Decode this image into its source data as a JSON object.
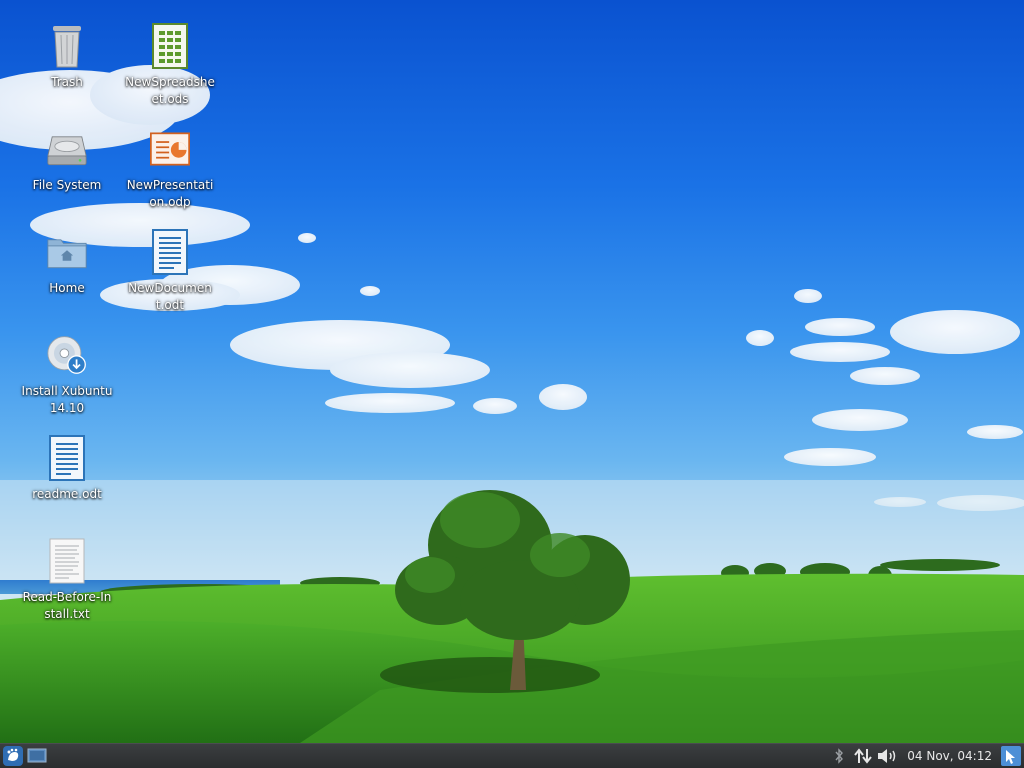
{
  "desktop": {
    "icons": [
      {
        "label": "Trash",
        "icon": "trash-icon"
      },
      {
        "label": "NewSpreadsheet.ods",
        "icon": "spreadsheet-file-icon"
      },
      {
        "label": "File System",
        "icon": "harddrive-icon"
      },
      {
        "label": "NewPresentation.odp",
        "icon": "presentation-file-icon"
      },
      {
        "label": "Home",
        "icon": "home-folder-icon"
      },
      {
        "label": "NewDocument.odt",
        "icon": "document-file-icon"
      },
      {
        "label": "Install Xubuntu 14.10",
        "icon": "install-disc-icon"
      },
      {
        "label": "readme.odt",
        "icon": "document-file-icon"
      },
      {
        "label": "Read-Before-Install.txt",
        "icon": "text-file-icon"
      }
    ]
  },
  "panel": {
    "menu_icon": "xfce-mouse-icon",
    "show_desktop_icon": "show-desktop-icon",
    "tray_icons": [
      "bluetooth-icon",
      "network-icon",
      "volume-icon"
    ],
    "clock": "04 Nov, 04:12",
    "action_icon": "action-buttons-icon"
  }
}
